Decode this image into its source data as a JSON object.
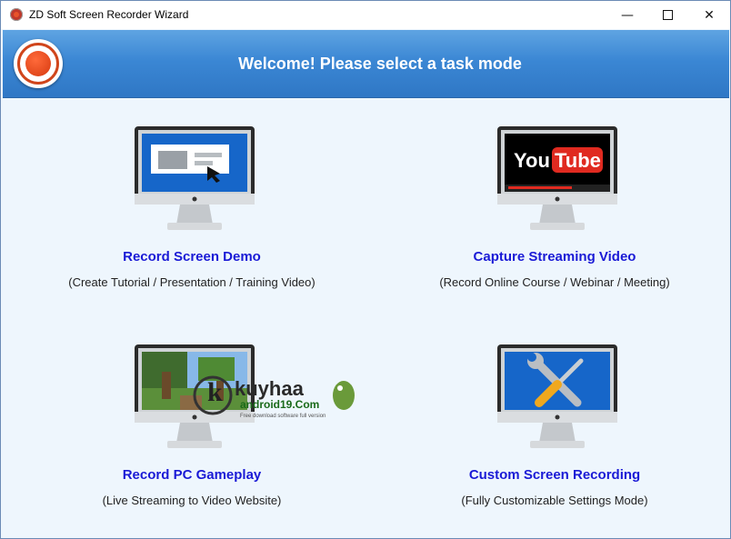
{
  "window": {
    "title": "ZD Soft Screen Recorder Wizard"
  },
  "banner": {
    "title": "Welcome! Please select a task mode"
  },
  "tasks": [
    {
      "title": "Record Screen Demo",
      "desc": "(Create Tutorial / Presentation / Training Video)"
    },
    {
      "title": "Capture Streaming Video",
      "desc": "(Record Online Course / Webinar / Meeting)"
    },
    {
      "title": "Record PC Gameplay",
      "desc": "(Live Streaming to Video Website)"
    },
    {
      "title": "Custom Screen Recording",
      "desc": "(Fully Customizable Settings Mode)"
    }
  ],
  "youtube": {
    "you": "You",
    "tube": "Tube"
  },
  "watermark": {
    "line1": "kuyhaa",
    "line2": "android19.Com",
    "line3": "Free download software full version"
  },
  "colors": {
    "banner": "#3b87d4",
    "task_title": "#1a1ad6",
    "logo": "#d63a10"
  }
}
